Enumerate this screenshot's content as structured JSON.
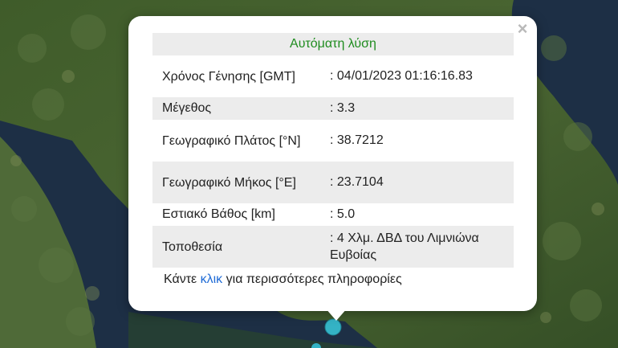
{
  "popup": {
    "close_label": "×",
    "header": "Αυτόματη λύση",
    "rows": [
      {
        "label": "Χρόνος Γένησης [GMT]",
        "value": ": 04/01/2023 01:16:16.83"
      },
      {
        "label": "Μέγεθος",
        "value": ": 3.3"
      },
      {
        "label": "Γεωγραφικό Πλάτος [°N]",
        "value": ": 38.7212"
      },
      {
        "label": "Γεωγραφικό Μήκος [°E]",
        "value": ": 23.7104"
      },
      {
        "label": "Εστιακό Βάθος [km]",
        "value": ": 5.0"
      },
      {
        "label": "Τοποθεσία",
        "value": ": 4 Χλμ. ΔΒΔ του Λιμνιώνα Ευβοίας"
      }
    ],
    "footer": {
      "before": "Κάντε ",
      "link": "κλικ",
      "after": " για περισσότερες πληροφορίες"
    }
  },
  "colors": {
    "header_green": "#1f8c1f",
    "link_blue": "#1f6bd6",
    "marker": "#34b3c5",
    "sea": "#1d2f45",
    "land": "#3d5a2a"
  }
}
